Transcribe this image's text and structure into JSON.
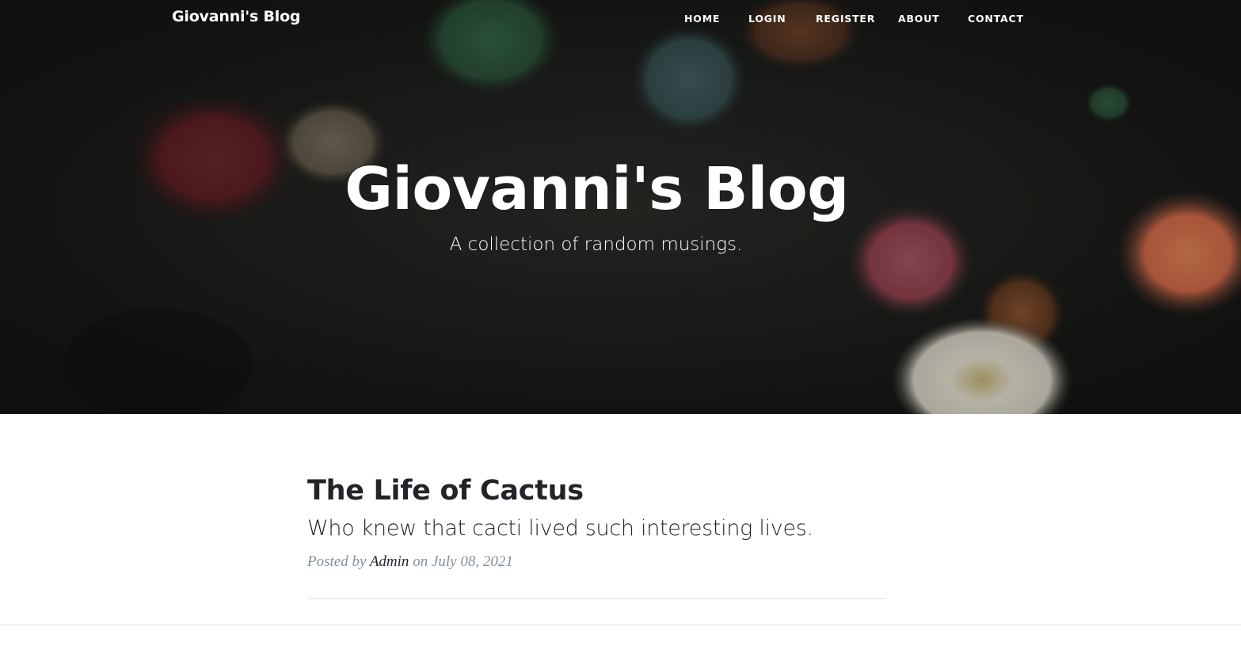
{
  "navbar": {
    "brand": "Giovanni's Blog",
    "links": [
      "HOME",
      "LOGIN",
      "REGISTER",
      "ABOUT",
      "CONTACT"
    ]
  },
  "hero": {
    "title": "Giovanni's Blog",
    "subtitle": "A collection of random musings."
  },
  "posts": [
    {
      "title": "The Life of Cactus",
      "subtitle": "Who knew that cacti lived such interesting lives.",
      "meta_prefix": "Posted by",
      "author": "Admin",
      "meta_on": "on",
      "date": "July 08, 2021"
    }
  ]
}
